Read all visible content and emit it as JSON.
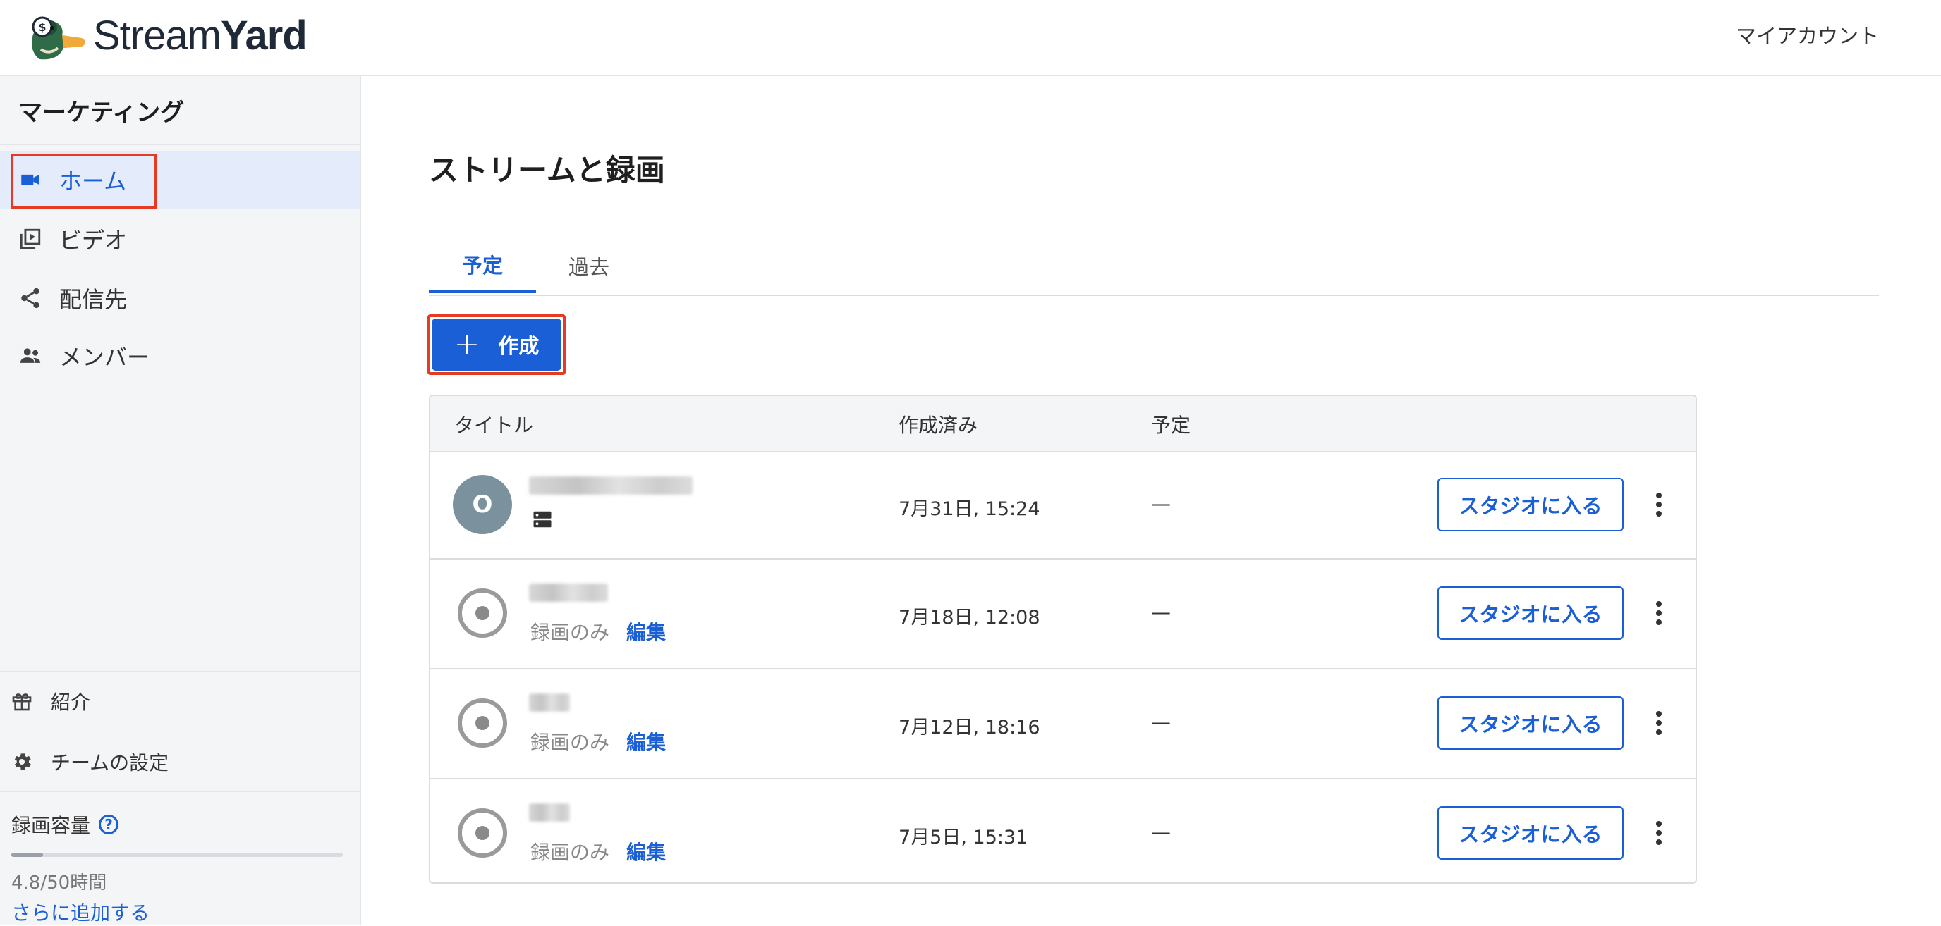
{
  "header": {
    "brand_part1": "Stream",
    "brand_part2": "Yard",
    "account_label": "マイアカウント"
  },
  "sidebar": {
    "team_name": "マーケティング",
    "nav": [
      {
        "label": "ホーム",
        "icon": "video-camera-icon",
        "active": true
      },
      {
        "label": "ビデオ",
        "icon": "video-library-icon",
        "active": false
      },
      {
        "label": "配信先",
        "icon": "share-icon",
        "active": false
      },
      {
        "label": "メンバー",
        "icon": "people-icon",
        "active": false
      }
    ],
    "bottom": [
      {
        "label": "紹介",
        "icon": "gift-icon"
      },
      {
        "label": "チームの設定",
        "icon": "gear-icon"
      }
    ],
    "storage": {
      "title": "録画容量",
      "usage_text": "4.8/50時間",
      "used_fraction": 0.096,
      "add_more_label": "さらに追加する"
    }
  },
  "main": {
    "title": "ストリームと録画",
    "tabs": [
      {
        "label": "予定",
        "active": true
      },
      {
        "label": "過去",
        "active": false
      }
    ],
    "create_button": {
      "plus": "+",
      "label": "作成"
    },
    "table": {
      "columns": [
        "タイトル",
        "作成済み",
        "予定"
      ],
      "rows": [
        {
          "avatar": "O",
          "type": "stream",
          "created": "7月31日, 15:24",
          "scheduled": "—",
          "action": "スタジオに入る"
        },
        {
          "type": "recording",
          "subtitle": "録画のみ",
          "edit": "編集",
          "created": "7月18日, 12:08",
          "scheduled": "—",
          "action": "スタジオに入る"
        },
        {
          "type": "recording",
          "subtitle": "録画のみ",
          "edit": "編集",
          "created": "7月12日, 18:16",
          "scheduled": "—",
          "action": "スタジオに入る"
        },
        {
          "type": "recording",
          "subtitle": "録画のみ",
          "edit": "編集",
          "created": "7月5日, 15:31",
          "scheduled": "—",
          "action": "スタジオに入る"
        }
      ]
    }
  },
  "colors": {
    "accent": "#1a5fd6",
    "highlight_outline": "#e53b22",
    "sidebar_bg": "#f4f5f7",
    "avatar_bg": "#7b929e"
  }
}
